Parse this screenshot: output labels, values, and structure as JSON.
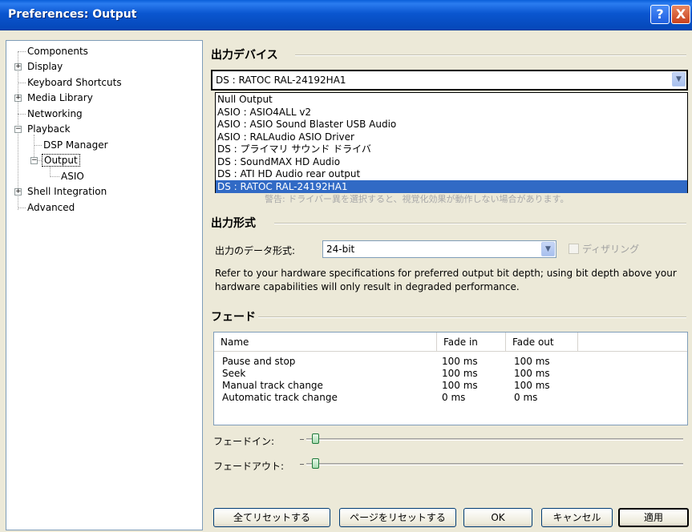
{
  "window": {
    "title": "Preferences: Output",
    "help_label": "?",
    "close_label": "X"
  },
  "tree": {
    "items": [
      {
        "label": "Components"
      },
      {
        "label": "Display"
      },
      {
        "label": "Keyboard Shortcuts"
      },
      {
        "label": "Media Library"
      },
      {
        "label": "Networking"
      },
      {
        "label": "Playback"
      },
      {
        "label": "DSP Manager"
      },
      {
        "label": "Output"
      },
      {
        "label": "ASIO"
      },
      {
        "label": "Shell Integration"
      },
      {
        "label": "Advanced"
      }
    ]
  },
  "output_device": {
    "section_title": "出力デバイス",
    "selected": "DS : RATOC RAL-24192HA1",
    "options": [
      "Null Output",
      "ASIO : ASIO4ALL v2",
      "ASIO : ASIO Sound Blaster USB Audio",
      "ASIO : RALAudio ASIO Driver",
      "DS : プライマリ サウンド ドライバ",
      "DS : SoundMAX HD Audio",
      "DS : ATI HD Audio rear output",
      "DS : RATOC RAL-24192HA1"
    ],
    "partial_warning": "警告: ドライバー異を選択すると、視覚化効果が動作しない場合があります。"
  },
  "output_format": {
    "section_title": "出力形式",
    "data_format_label": "出力のデータ形式:",
    "data_format_value": "24-bit",
    "dither_label": "ディザリング",
    "description": "Refer to your hardware specifications for preferred output bit depth; using bit depth above your hardware capabilities will only result in degraded performance."
  },
  "fade": {
    "section_title": "フェード",
    "columns": [
      "Name",
      "Fade in",
      "Fade out"
    ],
    "rows": [
      {
        "name": "Pause and stop",
        "fade_in": "100 ms",
        "fade_out": "100 ms"
      },
      {
        "name": "Seek",
        "fade_in": "100 ms",
        "fade_out": "100 ms"
      },
      {
        "name": "Manual track change",
        "fade_in": "100 ms",
        "fade_out": "100 ms"
      },
      {
        "name": "Automatic track change",
        "fade_in": "0 ms",
        "fade_out": "0 ms"
      }
    ],
    "fade_in_label": "フェードイン:",
    "fade_out_label": "フェードアウト:",
    "fade_in_level": 0.02,
    "fade_out_level": 0.02
  },
  "buttons": {
    "reset_all": "全てリセットする",
    "reset_page": "ページをリセットする",
    "ok": "OK",
    "cancel": "キャンセル",
    "apply": "適用"
  }
}
